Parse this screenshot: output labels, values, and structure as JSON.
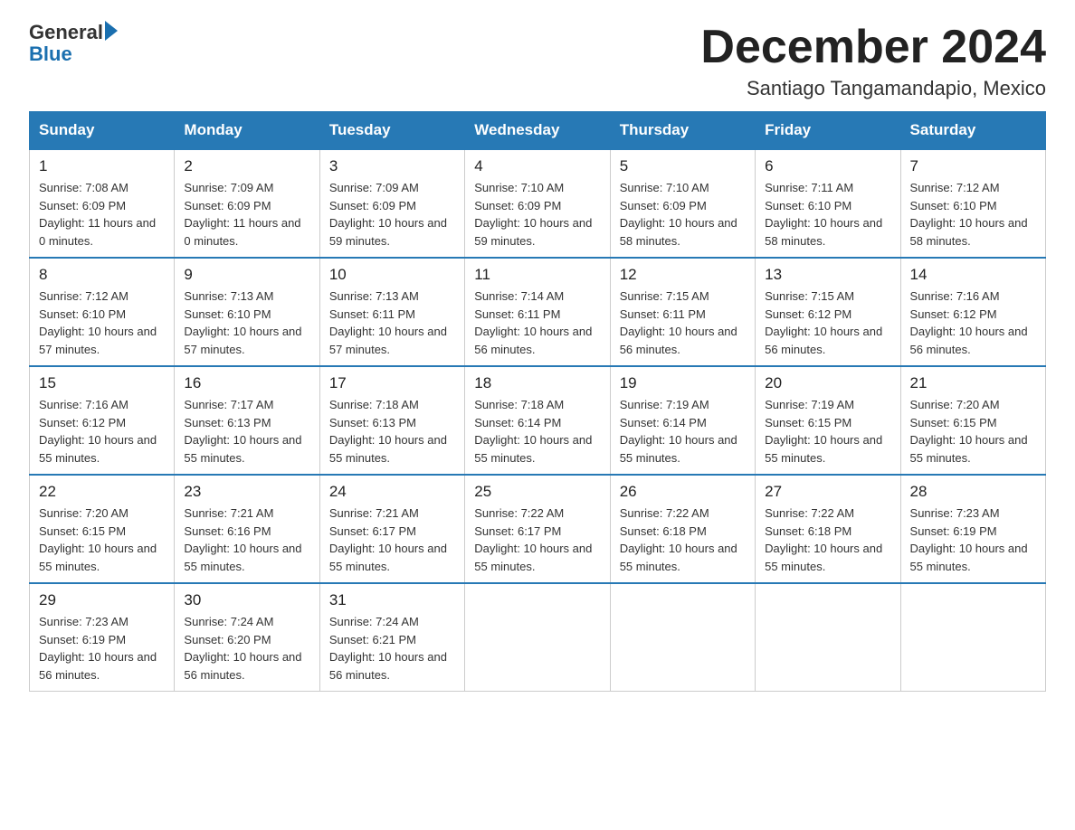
{
  "logo": {
    "general": "General",
    "blue": "Blue"
  },
  "title": "December 2024",
  "subtitle": "Santiago Tangamandapio, Mexico",
  "weekdays": [
    "Sunday",
    "Monday",
    "Tuesday",
    "Wednesday",
    "Thursday",
    "Friday",
    "Saturday"
  ],
  "weeks": [
    [
      {
        "day": "1",
        "sunrise": "7:08 AM",
        "sunset": "6:09 PM",
        "daylight": "11 hours and 0 minutes."
      },
      {
        "day": "2",
        "sunrise": "7:09 AM",
        "sunset": "6:09 PM",
        "daylight": "11 hours and 0 minutes."
      },
      {
        "day": "3",
        "sunrise": "7:09 AM",
        "sunset": "6:09 PM",
        "daylight": "10 hours and 59 minutes."
      },
      {
        "day": "4",
        "sunrise": "7:10 AM",
        "sunset": "6:09 PM",
        "daylight": "10 hours and 59 minutes."
      },
      {
        "day": "5",
        "sunrise": "7:10 AM",
        "sunset": "6:09 PM",
        "daylight": "10 hours and 58 minutes."
      },
      {
        "day": "6",
        "sunrise": "7:11 AM",
        "sunset": "6:10 PM",
        "daylight": "10 hours and 58 minutes."
      },
      {
        "day": "7",
        "sunrise": "7:12 AM",
        "sunset": "6:10 PM",
        "daylight": "10 hours and 58 minutes."
      }
    ],
    [
      {
        "day": "8",
        "sunrise": "7:12 AM",
        "sunset": "6:10 PM",
        "daylight": "10 hours and 57 minutes."
      },
      {
        "day": "9",
        "sunrise": "7:13 AM",
        "sunset": "6:10 PM",
        "daylight": "10 hours and 57 minutes."
      },
      {
        "day": "10",
        "sunrise": "7:13 AM",
        "sunset": "6:11 PM",
        "daylight": "10 hours and 57 minutes."
      },
      {
        "day": "11",
        "sunrise": "7:14 AM",
        "sunset": "6:11 PM",
        "daylight": "10 hours and 56 minutes."
      },
      {
        "day": "12",
        "sunrise": "7:15 AM",
        "sunset": "6:11 PM",
        "daylight": "10 hours and 56 minutes."
      },
      {
        "day": "13",
        "sunrise": "7:15 AM",
        "sunset": "6:12 PM",
        "daylight": "10 hours and 56 minutes."
      },
      {
        "day": "14",
        "sunrise": "7:16 AM",
        "sunset": "6:12 PM",
        "daylight": "10 hours and 56 minutes."
      }
    ],
    [
      {
        "day": "15",
        "sunrise": "7:16 AM",
        "sunset": "6:12 PM",
        "daylight": "10 hours and 55 minutes."
      },
      {
        "day": "16",
        "sunrise": "7:17 AM",
        "sunset": "6:13 PM",
        "daylight": "10 hours and 55 minutes."
      },
      {
        "day": "17",
        "sunrise": "7:18 AM",
        "sunset": "6:13 PM",
        "daylight": "10 hours and 55 minutes."
      },
      {
        "day": "18",
        "sunrise": "7:18 AM",
        "sunset": "6:14 PM",
        "daylight": "10 hours and 55 minutes."
      },
      {
        "day": "19",
        "sunrise": "7:19 AM",
        "sunset": "6:14 PM",
        "daylight": "10 hours and 55 minutes."
      },
      {
        "day": "20",
        "sunrise": "7:19 AM",
        "sunset": "6:15 PM",
        "daylight": "10 hours and 55 minutes."
      },
      {
        "day": "21",
        "sunrise": "7:20 AM",
        "sunset": "6:15 PM",
        "daylight": "10 hours and 55 minutes."
      }
    ],
    [
      {
        "day": "22",
        "sunrise": "7:20 AM",
        "sunset": "6:15 PM",
        "daylight": "10 hours and 55 minutes."
      },
      {
        "day": "23",
        "sunrise": "7:21 AM",
        "sunset": "6:16 PM",
        "daylight": "10 hours and 55 minutes."
      },
      {
        "day": "24",
        "sunrise": "7:21 AM",
        "sunset": "6:17 PM",
        "daylight": "10 hours and 55 minutes."
      },
      {
        "day": "25",
        "sunrise": "7:22 AM",
        "sunset": "6:17 PM",
        "daylight": "10 hours and 55 minutes."
      },
      {
        "day": "26",
        "sunrise": "7:22 AM",
        "sunset": "6:18 PM",
        "daylight": "10 hours and 55 minutes."
      },
      {
        "day": "27",
        "sunrise": "7:22 AM",
        "sunset": "6:18 PM",
        "daylight": "10 hours and 55 minutes."
      },
      {
        "day": "28",
        "sunrise": "7:23 AM",
        "sunset": "6:19 PM",
        "daylight": "10 hours and 55 minutes."
      }
    ],
    [
      {
        "day": "29",
        "sunrise": "7:23 AM",
        "sunset": "6:19 PM",
        "daylight": "10 hours and 56 minutes."
      },
      {
        "day": "30",
        "sunrise": "7:24 AM",
        "sunset": "6:20 PM",
        "daylight": "10 hours and 56 minutes."
      },
      {
        "day": "31",
        "sunrise": "7:24 AM",
        "sunset": "6:21 PM",
        "daylight": "10 hours and 56 minutes."
      },
      null,
      null,
      null,
      null
    ]
  ]
}
